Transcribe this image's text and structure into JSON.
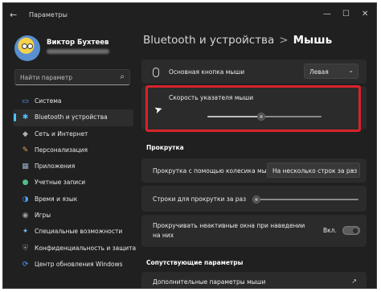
{
  "window": {
    "title": "Параметры",
    "back_icon": "←",
    "minimize_icon": "—",
    "maximize_icon": "☐",
    "close_icon": "✕"
  },
  "user": {
    "name": "Виктор Бухтеев"
  },
  "search": {
    "placeholder": "Найти параметр",
    "icon": "⌕"
  },
  "nav": {
    "items": [
      {
        "label": "Система",
        "icon": "▭",
        "color": "#4aa3ff"
      },
      {
        "label": "Bluetooth и устройства",
        "icon": "✱",
        "color": "#4cc2ff"
      },
      {
        "label": "Сеть и Интернет",
        "icon": "◆",
        "color": "#b0b0b0"
      },
      {
        "label": "Персонализация",
        "icon": "✎",
        "color": "#e0a060"
      },
      {
        "label": "Приложения",
        "icon": "▦",
        "color": "#9ab0c8"
      },
      {
        "label": "Учетные записи",
        "icon": "●",
        "color": "#4fc08a"
      },
      {
        "label": "Время и язык",
        "icon": "◑",
        "color": "#4aa3ff"
      },
      {
        "label": "Игры",
        "icon": "◉",
        "color": "#a0a0a0"
      },
      {
        "label": "Специальные возможности",
        "icon": "✦",
        "color": "#6fb8ff"
      },
      {
        "label": "Конфиденциальность и защита",
        "icon": "⛨",
        "color": "#8a8a8a"
      },
      {
        "label": "Центр обновления Windows",
        "icon": "⟳",
        "color": "#4aa3ff"
      }
    ]
  },
  "breadcrumb": {
    "parent": "Bluetooth и устройства",
    "separator": ">",
    "current": "Мышь"
  },
  "primary_button": {
    "label": "Основная кнопка мыши",
    "value": "Левая",
    "chevron": "⌄"
  },
  "pointer_speed": {
    "label": "Скорость указателя мыши",
    "value_fraction": 0.47
  },
  "scrolling": {
    "section_title": "Прокрутка",
    "wheel_label": "Прокрутка с помощью колесика мыши",
    "wheel_value": "На несколько строк за раз",
    "lines_label": "Строки для прокрутки за раз",
    "lines_fraction": 0.04,
    "inactive_label_1": "Прокручивать неактивные окна при наведении",
    "inactive_label_2": "на них",
    "inactive_state": "Вкл."
  },
  "related": {
    "section_title": "Сопутствующие параметры",
    "additional_label": "Дополнительные параметры мыши",
    "ext_icon": "↗"
  },
  "colors": {
    "accent": "#4cc2ff",
    "highlight_border": "#d8232a",
    "background": "#202020",
    "card": "#2b2b2b"
  }
}
